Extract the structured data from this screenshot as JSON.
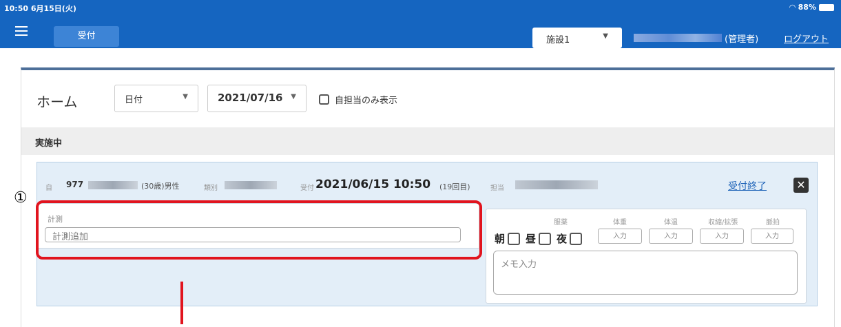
{
  "status_bar": {
    "time": "10:50  6月15日(火)",
    "battery": "88%"
  },
  "app_bar": {
    "reception_button": "受付",
    "facility_select": "施設1",
    "role": "(管理者)",
    "logout": "ログアウト"
  },
  "home": {
    "title": "ホーム",
    "filter_select": "日付",
    "date_select": "2021/07/16",
    "checkbox_label": "自担当のみ表示",
    "section_title": "実施中"
  },
  "patient": {
    "self_tag": "自",
    "patient_no": "977",
    "age_sex": "(30歳)男性",
    "category_caption": "類別",
    "reception_caption": "受付",
    "reception_datetime": "2021/06/15 10:50",
    "visit_count": "(19回目)",
    "charge_caption": "担当",
    "end_reception": "受付終了",
    "close": "✕"
  },
  "annotation": {
    "number": "①"
  },
  "measurement": {
    "caption": "計測",
    "input_placeholder": "計測追加"
  },
  "medication": {
    "caption": "服薬",
    "morning": "朝",
    "noon": "昼",
    "night": "夜"
  },
  "vitals": [
    {
      "caption": "体重",
      "button": "入力"
    },
    {
      "caption": "体温",
      "button": "入力"
    },
    {
      "caption": "収縮/拡張",
      "button": "入力"
    },
    {
      "caption": "脈拍",
      "button": "入力"
    }
  ],
  "memo": {
    "placeholder": "メモ入力"
  },
  "colors": {
    "brand": "#1565c0",
    "annotation_red": "#e1141e",
    "panel_bg": "#e3eef8"
  }
}
